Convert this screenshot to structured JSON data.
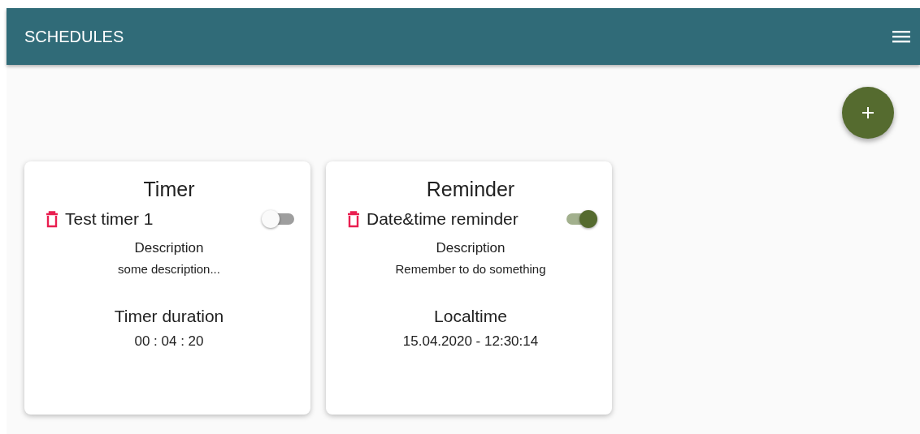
{
  "app_bar": {
    "title": "SCHEDULES"
  },
  "cards": [
    {
      "type": "Timer",
      "name": "Test timer 1",
      "enabled": false,
      "description_label": "Description",
      "description": "some description...",
      "detail_label": "Timer duration",
      "detail_value": "00 : 04 : 20"
    },
    {
      "type": "Reminder",
      "name": "Date&time reminder",
      "enabled": true,
      "description_label": "Description",
      "description": "Remember to do something",
      "detail_label": "Localtime",
      "detail_value": "15.04.2020 - 12:30:14"
    }
  ]
}
